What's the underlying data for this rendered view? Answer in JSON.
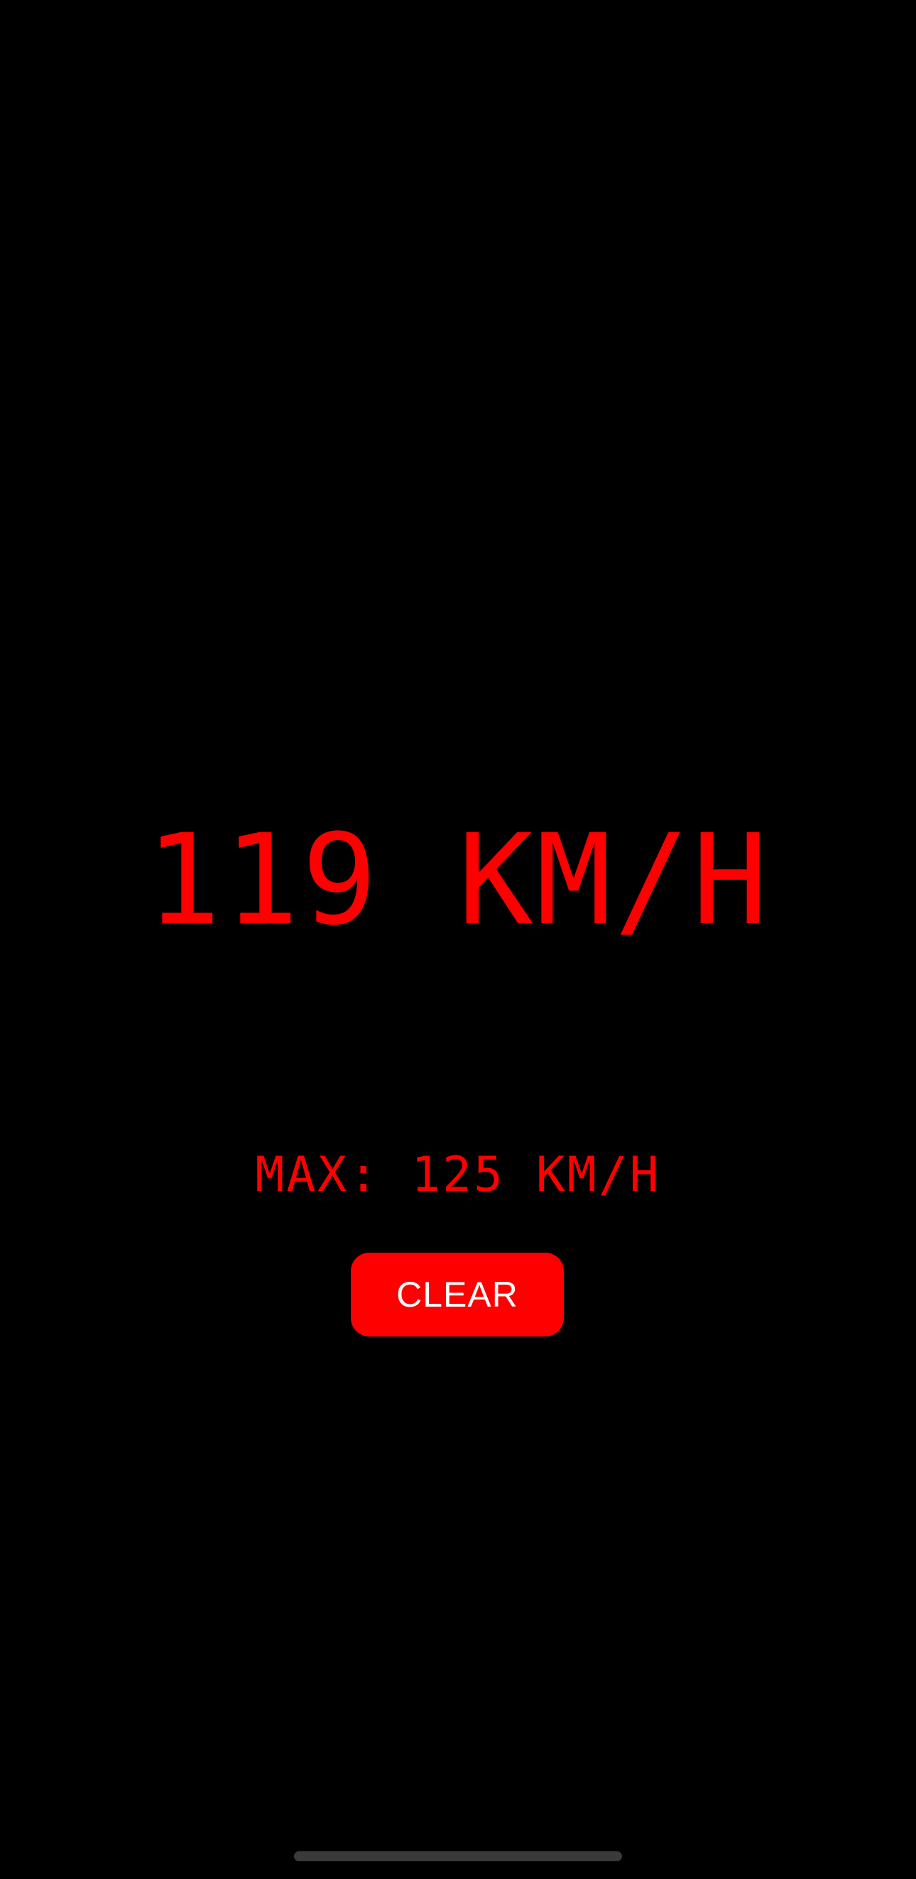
{
  "speedometer": {
    "current_speed": "119 KM/H",
    "max_speed": "MAX: 125 KM/H",
    "clear_label": "CLEAR"
  },
  "colors": {
    "background": "#000000",
    "display": "#ff0000",
    "button": "#ff0000",
    "button_text": "#ffffff"
  }
}
